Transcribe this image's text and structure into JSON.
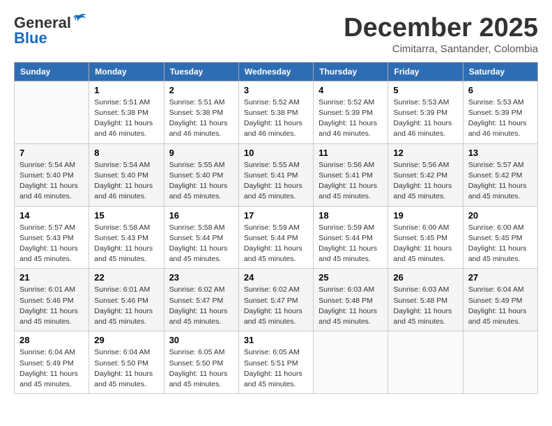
{
  "header": {
    "logo_general": "General",
    "logo_blue": "Blue",
    "month_title": "December 2025",
    "subtitle": "Cimitarra, Santander, Colombia"
  },
  "days_of_week": [
    "Sunday",
    "Monday",
    "Tuesday",
    "Wednesday",
    "Thursday",
    "Friday",
    "Saturday"
  ],
  "weeks": [
    [
      {
        "day": "",
        "sunrise": "",
        "sunset": "",
        "daylight": ""
      },
      {
        "day": "1",
        "sunrise": "Sunrise: 5:51 AM",
        "sunset": "Sunset: 5:38 PM",
        "daylight": "Daylight: 11 hours and 46 minutes."
      },
      {
        "day": "2",
        "sunrise": "Sunrise: 5:51 AM",
        "sunset": "Sunset: 5:38 PM",
        "daylight": "Daylight: 11 hours and 46 minutes."
      },
      {
        "day": "3",
        "sunrise": "Sunrise: 5:52 AM",
        "sunset": "Sunset: 5:38 PM",
        "daylight": "Daylight: 11 hours and 46 minutes."
      },
      {
        "day": "4",
        "sunrise": "Sunrise: 5:52 AM",
        "sunset": "Sunset: 5:39 PM",
        "daylight": "Daylight: 11 hours and 46 minutes."
      },
      {
        "day": "5",
        "sunrise": "Sunrise: 5:53 AM",
        "sunset": "Sunset: 5:39 PM",
        "daylight": "Daylight: 11 hours and 46 minutes."
      },
      {
        "day": "6",
        "sunrise": "Sunrise: 5:53 AM",
        "sunset": "Sunset: 5:39 PM",
        "daylight": "Daylight: 11 hours and 46 minutes."
      }
    ],
    [
      {
        "day": "7",
        "sunrise": "Sunrise: 5:54 AM",
        "sunset": "Sunset: 5:40 PM",
        "daylight": "Daylight: 11 hours and 46 minutes."
      },
      {
        "day": "8",
        "sunrise": "Sunrise: 5:54 AM",
        "sunset": "Sunset: 5:40 PM",
        "daylight": "Daylight: 11 hours and 46 minutes."
      },
      {
        "day": "9",
        "sunrise": "Sunrise: 5:55 AM",
        "sunset": "Sunset: 5:40 PM",
        "daylight": "Daylight: 11 hours and 45 minutes."
      },
      {
        "day": "10",
        "sunrise": "Sunrise: 5:55 AM",
        "sunset": "Sunset: 5:41 PM",
        "daylight": "Daylight: 11 hours and 45 minutes."
      },
      {
        "day": "11",
        "sunrise": "Sunrise: 5:56 AM",
        "sunset": "Sunset: 5:41 PM",
        "daylight": "Daylight: 11 hours and 45 minutes."
      },
      {
        "day": "12",
        "sunrise": "Sunrise: 5:56 AM",
        "sunset": "Sunset: 5:42 PM",
        "daylight": "Daylight: 11 hours and 45 minutes."
      },
      {
        "day": "13",
        "sunrise": "Sunrise: 5:57 AM",
        "sunset": "Sunset: 5:42 PM",
        "daylight": "Daylight: 11 hours and 45 minutes."
      }
    ],
    [
      {
        "day": "14",
        "sunrise": "Sunrise: 5:57 AM",
        "sunset": "Sunset: 5:43 PM",
        "daylight": "Daylight: 11 hours and 45 minutes."
      },
      {
        "day": "15",
        "sunrise": "Sunrise: 5:58 AM",
        "sunset": "Sunset: 5:43 PM",
        "daylight": "Daylight: 11 hours and 45 minutes."
      },
      {
        "day": "16",
        "sunrise": "Sunrise: 5:58 AM",
        "sunset": "Sunset: 5:44 PM",
        "daylight": "Daylight: 11 hours and 45 minutes."
      },
      {
        "day": "17",
        "sunrise": "Sunrise: 5:59 AM",
        "sunset": "Sunset: 5:44 PM",
        "daylight": "Daylight: 11 hours and 45 minutes."
      },
      {
        "day": "18",
        "sunrise": "Sunrise: 5:59 AM",
        "sunset": "Sunset: 5:44 PM",
        "daylight": "Daylight: 11 hours and 45 minutes."
      },
      {
        "day": "19",
        "sunrise": "Sunrise: 6:00 AM",
        "sunset": "Sunset: 5:45 PM",
        "daylight": "Daylight: 11 hours and 45 minutes."
      },
      {
        "day": "20",
        "sunrise": "Sunrise: 6:00 AM",
        "sunset": "Sunset: 5:45 PM",
        "daylight": "Daylight: 11 hours and 45 minutes."
      }
    ],
    [
      {
        "day": "21",
        "sunrise": "Sunrise: 6:01 AM",
        "sunset": "Sunset: 5:46 PM",
        "daylight": "Daylight: 11 hours and 45 minutes."
      },
      {
        "day": "22",
        "sunrise": "Sunrise: 6:01 AM",
        "sunset": "Sunset: 5:46 PM",
        "daylight": "Daylight: 11 hours and 45 minutes."
      },
      {
        "day": "23",
        "sunrise": "Sunrise: 6:02 AM",
        "sunset": "Sunset: 5:47 PM",
        "daylight": "Daylight: 11 hours and 45 minutes."
      },
      {
        "day": "24",
        "sunrise": "Sunrise: 6:02 AM",
        "sunset": "Sunset: 5:47 PM",
        "daylight": "Daylight: 11 hours and 45 minutes."
      },
      {
        "day": "25",
        "sunrise": "Sunrise: 6:03 AM",
        "sunset": "Sunset: 5:48 PM",
        "daylight": "Daylight: 11 hours and 45 minutes."
      },
      {
        "day": "26",
        "sunrise": "Sunrise: 6:03 AM",
        "sunset": "Sunset: 5:48 PM",
        "daylight": "Daylight: 11 hours and 45 minutes."
      },
      {
        "day": "27",
        "sunrise": "Sunrise: 6:04 AM",
        "sunset": "Sunset: 5:49 PM",
        "daylight": "Daylight: 11 hours and 45 minutes."
      }
    ],
    [
      {
        "day": "28",
        "sunrise": "Sunrise: 6:04 AM",
        "sunset": "Sunset: 5:49 PM",
        "daylight": "Daylight: 11 hours and 45 minutes."
      },
      {
        "day": "29",
        "sunrise": "Sunrise: 6:04 AM",
        "sunset": "Sunset: 5:50 PM",
        "daylight": "Daylight: 11 hours and 45 minutes."
      },
      {
        "day": "30",
        "sunrise": "Sunrise: 6:05 AM",
        "sunset": "Sunset: 5:50 PM",
        "daylight": "Daylight: 11 hours and 45 minutes."
      },
      {
        "day": "31",
        "sunrise": "Sunrise: 6:05 AM",
        "sunset": "Sunset: 5:51 PM",
        "daylight": "Daylight: 11 hours and 45 minutes."
      },
      {
        "day": "",
        "sunrise": "",
        "sunset": "",
        "daylight": ""
      },
      {
        "day": "",
        "sunrise": "",
        "sunset": "",
        "daylight": ""
      },
      {
        "day": "",
        "sunrise": "",
        "sunset": "",
        "daylight": ""
      }
    ]
  ]
}
